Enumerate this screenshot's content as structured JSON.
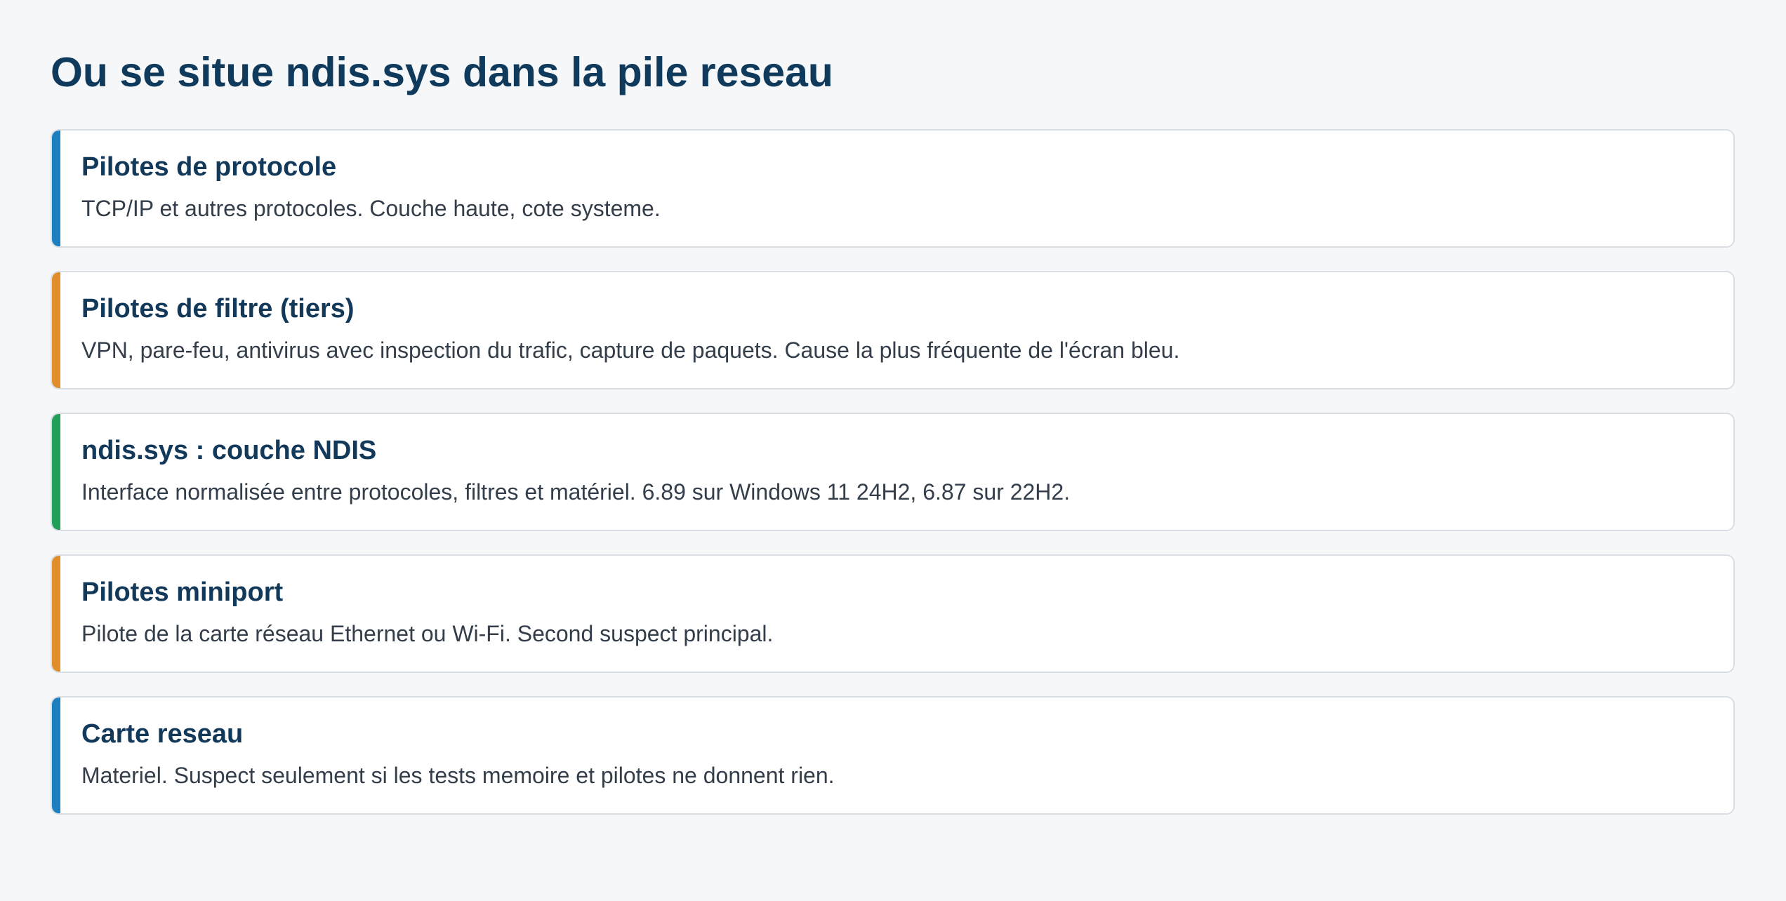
{
  "title": "Ou se situe ndis.sys dans la pile reseau",
  "layers": [
    {
      "title": "Pilotes de protocole",
      "description": "TCP/IP et autres protocoles. Couche haute, cote systeme.",
      "accent_color": "#1b7fc0"
    },
    {
      "title": "Pilotes de filtre (tiers)",
      "description": "VPN, pare-feu, antivirus avec inspection du trafic, capture de paquets. Cause la plus fréquente de l'écran bleu.",
      "accent_color": "#e08d2a"
    },
    {
      "title": "ndis.sys : couche NDIS",
      "description": "Interface normalisée entre protocoles, filtres et matériel. 6.89 sur Windows 11 24H2, 6.87 sur 22H2.",
      "accent_color": "#22a05a"
    },
    {
      "title": "Pilotes miniport",
      "description": "Pilote de la carte réseau Ethernet ou Wi-Fi. Second suspect principal.",
      "accent_color": "#e08d2a"
    },
    {
      "title": "Carte reseau",
      "description": "Materiel. Suspect seulement si les tests memoire et pilotes ne donnent rien.",
      "accent_color": "#1b7fc0"
    }
  ]
}
